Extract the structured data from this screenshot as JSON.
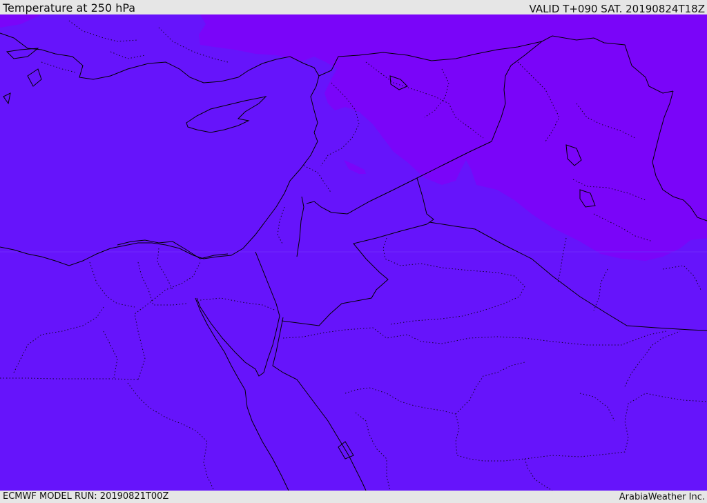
{
  "header": {
    "title": "Temperature at 250 hPa",
    "valid": "VALID T+090 SAT. 20190824T18Z"
  },
  "footer": {
    "model_run": "ECMWF MODEL RUN: 20190821T00Z",
    "credit": "ArabiaWeather Inc."
  },
  "map": {
    "base_color": "#6614fb",
    "warm_color": "#7a05f9",
    "border_color": "#000000"
  }
}
